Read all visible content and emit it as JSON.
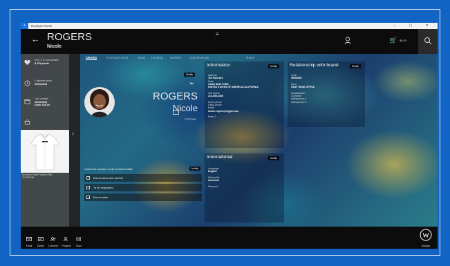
{
  "titlebar": {
    "title": "Boutique Mode",
    "store_icon": "+",
    "controls": "– ▢ ✕"
  },
  "header": {
    "surname": "ROGERS",
    "firstname": "Nicole",
    "back": "←",
    "menu": "≡",
    "cart_icon": "🛒",
    "cart_amount": "$0.00"
  },
  "tabs": [
    {
      "label": "Identity",
      "active": true
    },
    {
      "label": "Purchase trend",
      "active": false
    },
    {
      "label": "Taste",
      "active": false
    },
    {
      "label": "Tracking",
      "active": false
    },
    {
      "label": "Wishlist",
      "active": false
    },
    {
      "label": "Appointments",
      "active": false
    },
    {
      "label": "Notes",
      "active": false
    }
  ],
  "sidebar": {
    "rows": [
      {
        "icon": "heart-icon",
        "line1": "VIC / 5 & 0 purchases",
        "line2": "$ 475 points"
      },
      {
        "icon": "clock-icon",
        "line1": "Customer since",
        "line2": "01/01/2018"
      },
      {
        "icon": "calendar-icon",
        "line1": "Last contact",
        "line2": "16/10/2018",
        "line3": "Order 100.00"
      },
      {
        "icon": "basket-icon",
        "line1": "",
        "line2": ""
      }
    ],
    "product_caption_1": "Business Shirts Popelin Shirt",
    "product_caption_2": "12/02/2018"
  },
  "identity": {
    "modify_label": "Modify",
    "badge": "Ms",
    "surname": "ROGERS",
    "firstname": "Nicole",
    "id": "TUTO7681"
  },
  "consent": {
    "title": "Customer consent on all contact details",
    "modify_label": "Modify",
    "items": [
      "Brand name and partner",
      "To be requested",
      "Brand sales"
    ]
  },
  "information": {
    "title": "Information",
    "modify_label": "Modify",
    "address_label": "Address",
    "address_1": "700 Park Ave",
    "address_2": "Suite",
    "address_3": "10024 NEW YORK",
    "address_4": "UNITED STATES OF AMERICA CALIFORNIA",
    "cell_label": "Cell phone",
    "cell_value": "212-555-3355",
    "home_label": "Home phone",
    "office_label": "Office phone",
    "email_label": "Email",
    "email_value": "nicole.rogers@mygirl.com",
    "email2_label": "Email 2"
  },
  "international": {
    "title": "International",
    "modify_label": "Modify",
    "language_label": "Language",
    "language_value": "English",
    "nationality_label": "Nationality",
    "nationality_value": "American",
    "passport_label": "Passport"
  },
  "relationship": {
    "title": "Relationship with brand",
    "modify_label": "Modify",
    "code_label": "Code",
    "code_value": "99999999",
    "store_label": "Store",
    "store_value": "USNY HEAD OFFICE",
    "classification_label": "Classification",
    "contact_label": "Comment",
    "salesperson1_label": "Salesperson 2",
    "salesperson2_label": "Salesperson 3"
  },
  "bottombar": {
    "items": [
      {
        "icon": "email-icon",
        "label": "Email"
      },
      {
        "icon": "edit-icon",
        "label": "Edition"
      },
      {
        "icon": "customer-icon",
        "label": "Customer"
      },
      {
        "icon": "prospect-icon",
        "label": "Prospect"
      },
      {
        "icon": "scan-icon",
        "label": "Scan"
      }
    ],
    "brand_label": "Boutique"
  },
  "colors": {
    "background": "#1164c4",
    "bar": "#0c0c0c",
    "panel": "#464646"
  }
}
